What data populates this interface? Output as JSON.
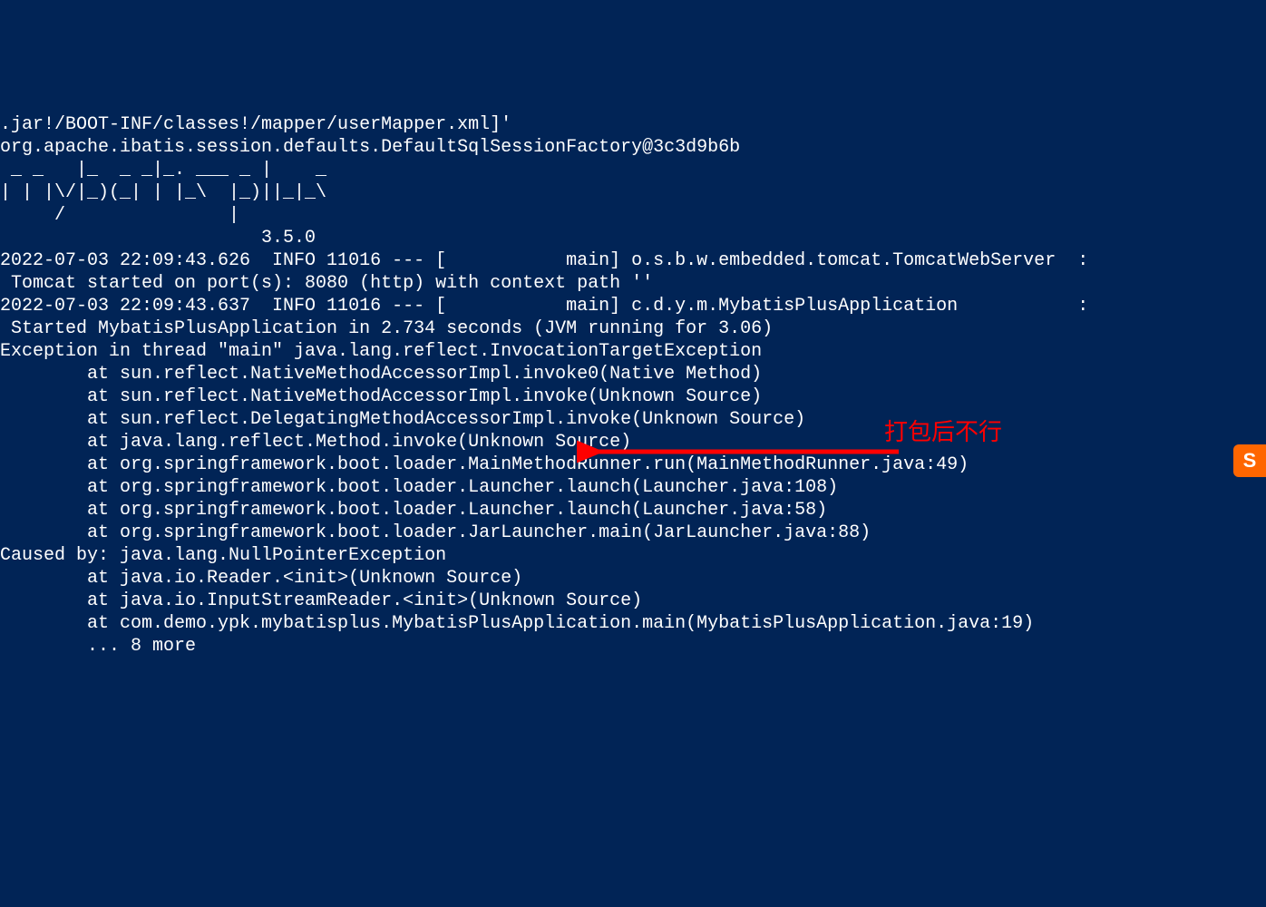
{
  "terminal": {
    "lines": [
      ".jar!/BOOT-INF/classes!/mapper/userMapper.xml]'",
      "org.apache.ibatis.session.defaults.DefaultSqlSessionFactory@3c3d9b6b",
      " _ _   |_  _ _|_. ___ _ |    _ ",
      "| | |\\/|_)(_| | |_\\  |_)||_|_\\ ",
      "     /               |         ",
      "                        3.5.0 ",
      "2022-07-03 22:09:43.626  INFO 11016 --- [           main] o.s.b.w.embedded.tomcat.TomcatWebServer  :",
      " Tomcat started on port(s): 8080 (http) with context path ''",
      "2022-07-03 22:09:43.637  INFO 11016 --- [           main] c.d.y.m.MybatisPlusApplication           :",
      " Started MybatisPlusApplication in 2.734 seconds (JVM running for 3.06)",
      "Exception in thread \"main\" java.lang.reflect.InvocationTargetException",
      "        at sun.reflect.NativeMethodAccessorImpl.invoke0(Native Method)",
      "        at sun.reflect.NativeMethodAccessorImpl.invoke(Unknown Source)",
      "        at sun.reflect.DelegatingMethodAccessorImpl.invoke(Unknown Source)",
      "        at java.lang.reflect.Method.invoke(Unknown Source)",
      "        at org.springframework.boot.loader.MainMethodRunner.run(MainMethodRunner.java:49)",
      "        at org.springframework.boot.loader.Launcher.launch(Launcher.java:108)",
      "        at org.springframework.boot.loader.Launcher.launch(Launcher.java:58)",
      "        at org.springframework.boot.loader.JarLauncher.main(JarLauncher.java:88)",
      "Caused by: java.lang.NullPointerException",
      "        at java.io.Reader.<init>(Unknown Source)",
      "        at java.io.InputStreamReader.<init>(Unknown Source)",
      "        at com.demo.ypk.mybatisplus.MybatisPlusApplication.main(MybatisPlusApplication.java:19)",
      "        ... 8 more"
    ]
  },
  "annotation": {
    "text": "打包后不行"
  },
  "badge": {
    "letter": "S"
  }
}
